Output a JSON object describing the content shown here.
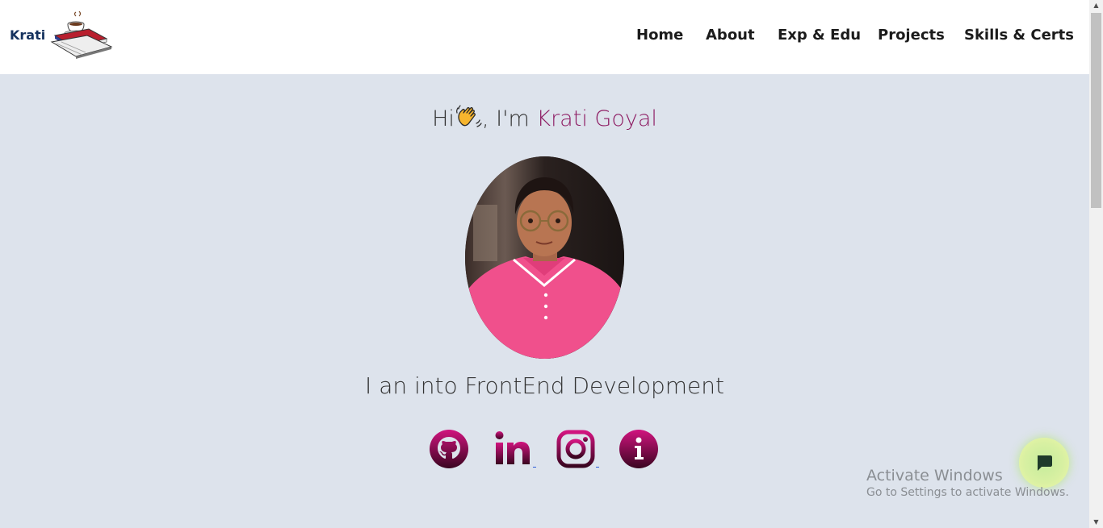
{
  "header": {
    "logo_text": "Krati",
    "nav": [
      {
        "label": "Home"
      },
      {
        "label": "About"
      },
      {
        "label": "Exp & Edu"
      },
      {
        "label": "Projects"
      },
      {
        "label": "Skills & Certs"
      }
    ]
  },
  "hero": {
    "greeting_prefix": "Hi",
    "greeting_middle": ", I'm ",
    "name": "Krati Goyal",
    "tagline": "I an into FrontEnd Development"
  },
  "socials": [
    {
      "icon": "github-icon"
    },
    {
      "icon": "linkedin-icon"
    },
    {
      "icon": "instagram-icon"
    },
    {
      "icon": "info-icon"
    }
  ],
  "overlay": {
    "activate_title": "Activate Windows",
    "activate_sub": "Go to Settings to activate Windows."
  },
  "colors": {
    "accent": "#8e1d64",
    "background": "#dde3ec",
    "icon_gradient_top": "#d1147f",
    "icon_gradient_bottom": "#3a0520"
  }
}
